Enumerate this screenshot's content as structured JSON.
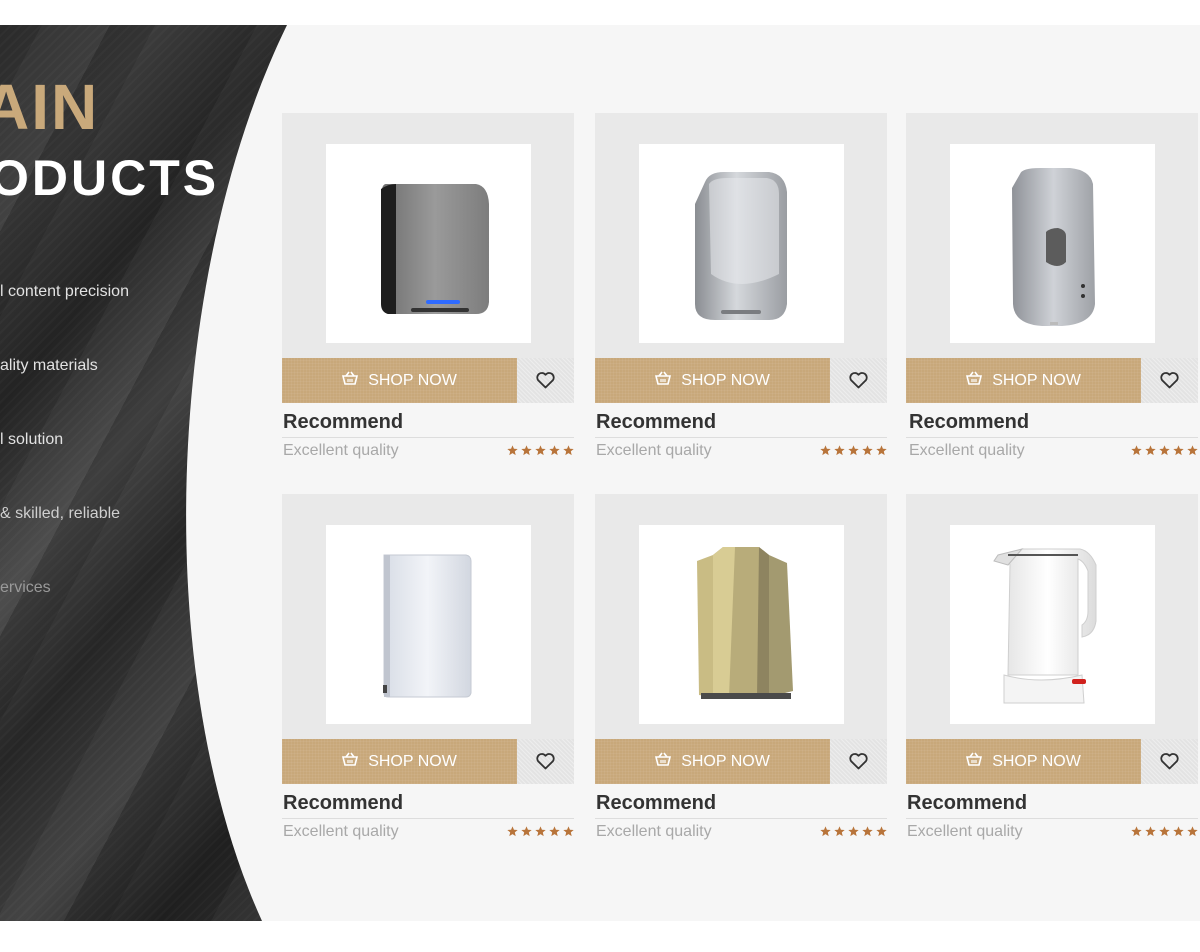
{
  "hero": {
    "title_line1": "AIN",
    "title_line2": "ODUCTS",
    "features": [
      "l content precision",
      "ality materials",
      "l solution",
      "& skilled, reliable",
      "ervices"
    ]
  },
  "colors": {
    "accent": "#c8a87a",
    "star": "#b8743a",
    "dark_panel": "#2e2e2e",
    "stage_bg": "#f6f6f6"
  },
  "products": [
    {
      "image": "hand-dryer-silver-wide",
      "shop_label": "SHOP NOW",
      "title": "Recommend",
      "subtitle": "Excellent quality",
      "rating": 5
    },
    {
      "image": "hand-dryer-silver-tall",
      "shop_label": "SHOP NOW",
      "title": "Recommend",
      "subtitle": "Excellent quality",
      "rating": 5
    },
    {
      "image": "soap-dispenser-silver",
      "shop_label": "SHOP NOW",
      "title": "Recommend",
      "subtitle": "Excellent quality",
      "rating": 5
    },
    {
      "image": "hand-dryer-white-slim",
      "shop_label": "SHOP NOW",
      "title": "Recommend",
      "subtitle": "Excellent quality",
      "rating": 5
    },
    {
      "image": "hand-dryer-gold",
      "shop_label": "SHOP NOW",
      "title": "Recommend",
      "subtitle": "Excellent quality",
      "rating": 5
    },
    {
      "image": "electric-kettle-white",
      "shop_label": "SHOP NOW",
      "title": "Recommend",
      "subtitle": "Excellent quality",
      "rating": 5
    }
  ]
}
